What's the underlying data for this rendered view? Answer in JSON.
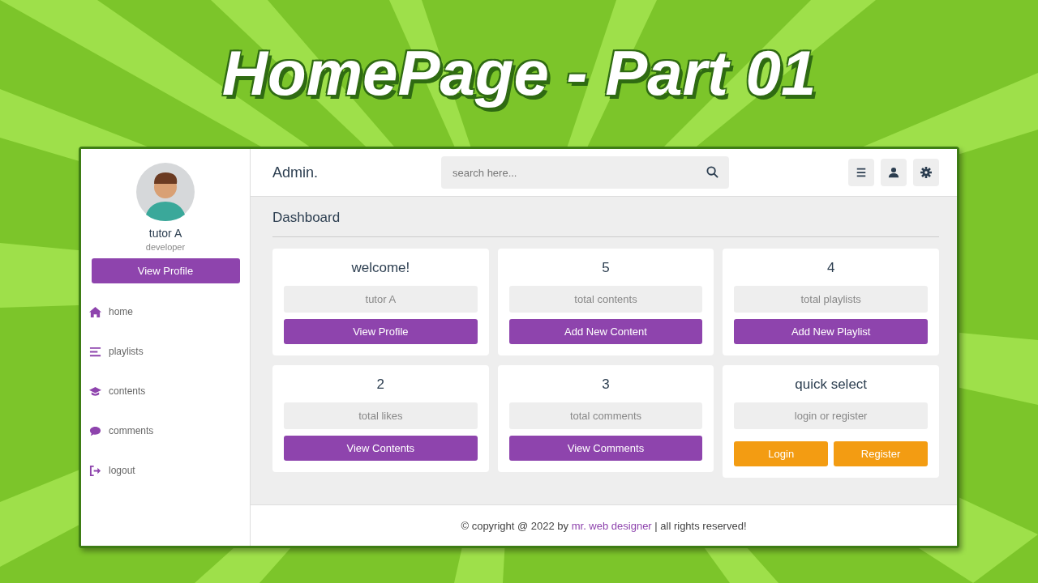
{
  "banner": {
    "title": "HomePage - Part 01"
  },
  "sidebar": {
    "profile": {
      "name": "tutor A",
      "role": "developer",
      "button": "View Profile"
    },
    "nav": [
      {
        "label": "home"
      },
      {
        "label": "playlists"
      },
      {
        "label": "contents"
      },
      {
        "label": "comments"
      },
      {
        "label": "logout"
      }
    ]
  },
  "header": {
    "brand": "Admin.",
    "search": {
      "placeholder": "search here..."
    }
  },
  "page_title": "Dashboard",
  "cards": [
    {
      "heading": "welcome!",
      "label": "tutor A",
      "buttons": [
        {
          "label": "View Profile",
          "kind": "primary"
        }
      ]
    },
    {
      "heading": "5",
      "label": "total contents",
      "buttons": [
        {
          "label": "Add New Content",
          "kind": "primary"
        }
      ]
    },
    {
      "heading": "4",
      "label": "total playlists",
      "buttons": [
        {
          "label": "Add New Playlist",
          "kind": "primary"
        }
      ]
    },
    {
      "heading": "2",
      "label": "total likes",
      "buttons": [
        {
          "label": "View Contents",
          "kind": "primary"
        }
      ]
    },
    {
      "heading": "3",
      "label": "total comments",
      "buttons": [
        {
          "label": "View Comments",
          "kind": "primary"
        }
      ]
    },
    {
      "heading": "quick select",
      "label": "login or register",
      "buttons": [
        {
          "label": "Login",
          "kind": "warning"
        },
        {
          "label": "Register",
          "kind": "warning"
        }
      ]
    }
  ],
  "footer": {
    "prefix": "© copyright @ 2022 by ",
    "link": "mr. web designer",
    "suffix": " | all rights reserved!"
  }
}
